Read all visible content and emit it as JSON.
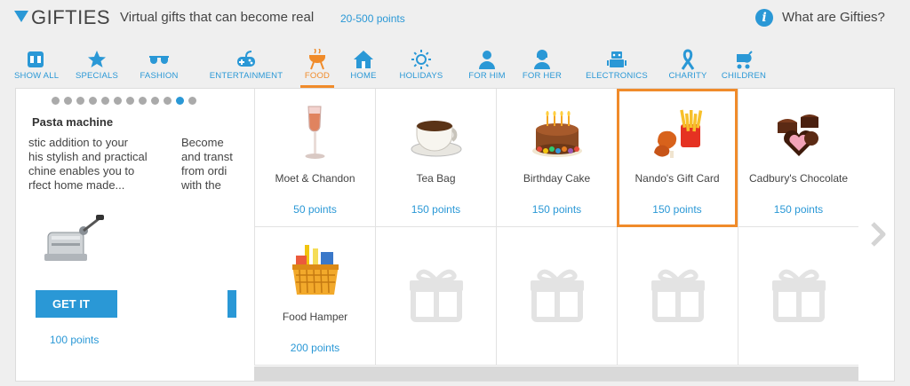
{
  "header": {
    "title": "GIFTIES",
    "subtitle": "Virtual gifts that can become real",
    "range": "20-500 points",
    "info_label": "What are Gifties?",
    "info_glyph": "i"
  },
  "categories": [
    {
      "label": "SHOW ALL",
      "icon": "show-all-icon"
    },
    {
      "label": "SPECIALS",
      "icon": "star-icon"
    },
    {
      "label": "FASHION",
      "icon": "sunglasses-icon"
    },
    {
      "label": "ENTERTAINMENT",
      "icon": "gamepad-icon"
    },
    {
      "label": "FOOD",
      "icon": "grill-icon",
      "active": true
    },
    {
      "label": "HOME",
      "icon": "house-icon"
    },
    {
      "label": "HOLIDAYS",
      "icon": "sun-icon"
    },
    {
      "label": "FOR HIM",
      "icon": "man-icon"
    },
    {
      "label": "FOR HER",
      "icon": "woman-icon"
    },
    {
      "label": "ELECTRONICS",
      "icon": "robot-icon"
    },
    {
      "label": "CHARITY",
      "icon": "ribbon-icon"
    },
    {
      "label": "CHILDREN",
      "icon": "stroller-icon"
    }
  ],
  "feature": {
    "title": "Pasta machine",
    "desc_lines": [
      "stic addition to your",
      "his stylish and practical",
      "chine enables you to",
      "rfect home made..."
    ],
    "desc2_lines": [
      "Become",
      "and transt",
      "from ordi",
      "with the"
    ],
    "button_label": "GET IT",
    "points": "100 points",
    "slides_total": 12,
    "slide_active": 11
  },
  "items": [
    {
      "name": "Moet & Chandon",
      "points": "50 points",
      "icon": "champagne-glass-icon"
    },
    {
      "name": "Tea Bag",
      "points": "150 points",
      "icon": "tea-cup-icon"
    },
    {
      "name": "Birthday Cake",
      "points": "150 points",
      "icon": "birthday-cake-icon"
    },
    {
      "name": "Nando's Gift Card",
      "points": "150 points",
      "icon": "chicken-fries-icon",
      "selected": true
    },
    {
      "name": "Cadbury's Chocolate",
      "points": "150 points",
      "icon": "chocolates-icon"
    },
    {
      "name": "Food Hamper",
      "points": "200 points",
      "icon": "hamper-basket-icon"
    }
  ],
  "empty_slots": 4,
  "colors": {
    "accent": "#2a98d6",
    "active": "#f08b2a"
  }
}
